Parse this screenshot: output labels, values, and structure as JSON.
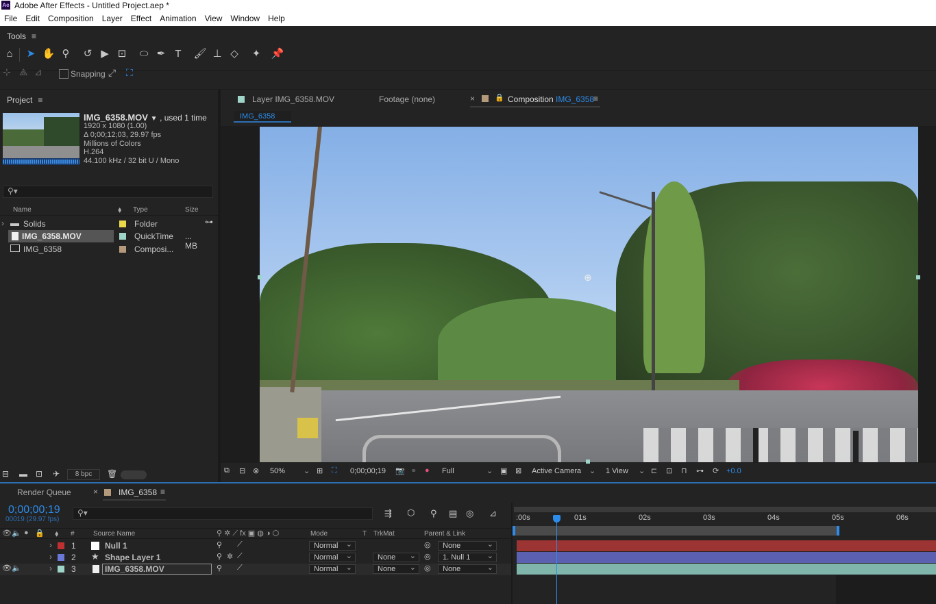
{
  "window": {
    "app_title": "Adobe After Effects - Untitled Project.aep *",
    "logo": "Ae"
  },
  "menu": [
    "File",
    "Edit",
    "Composition",
    "Layer",
    "Effect",
    "Animation",
    "View",
    "Window",
    "Help"
  ],
  "tools_panel": {
    "title": "Tools",
    "snapping_label": "Snapping"
  },
  "project": {
    "title": "Project",
    "selected_name": "IMG_6358.MOV",
    "used_text": ", used 1 time",
    "info": [
      "1920 x 1080 (1.00)",
      "Δ 0;00;12;03, 29.97 fps",
      "Millions of Colors",
      "H.264",
      "44.100 kHz / 32 bit U / Mono"
    ],
    "columns": {
      "name": "Name",
      "type": "Type",
      "size": "Size"
    },
    "items": [
      {
        "name": "Solids",
        "type": "Folder",
        "size": "",
        "color": "#e8d84a"
      },
      {
        "name": "IMG_6358.MOV",
        "type": "QuickTime",
        "size": "... MB",
        "color": "#9fd4c8"
      },
      {
        "name": "IMG_6358",
        "type": "Composi...",
        "size": "",
        "color": "#b49a7a"
      }
    ],
    "bpc": "8 bpc"
  },
  "viewer": {
    "tabs": {
      "layer": "Layer IMG_6358.MOV",
      "footage": "Footage (none)",
      "comp_prefix": "Composition",
      "comp_name": "IMG_6358"
    },
    "breadcrumb": "IMG_6358",
    "zoom": "50%",
    "timecode": "0;00;00;19",
    "resolution": "Full",
    "camera": "Active Camera",
    "views": "1 View",
    "exposure": "+0.0"
  },
  "timeline": {
    "tabs": {
      "render_queue": "Render Queue",
      "comp": "IMG_6358"
    },
    "current_time": "0;00;00;19",
    "frame_info": "00019 (29.97 fps)",
    "col_headers": {
      "num": "#",
      "source": "Source Name",
      "mode": "Mode",
      "t": "T",
      "trkmat": "TrkMat",
      "parent": "Parent & Link"
    },
    "ruler": [
      ":00s",
      "01s",
      "02s",
      "03s",
      "04s",
      "05s",
      "06s"
    ],
    "layers": [
      {
        "num": "1",
        "name": "Null 1",
        "mode": "Normal",
        "trkmat": "",
        "parent": "None",
        "label_color": "#c03030",
        "bar_color": "#9c3434"
      },
      {
        "num": "2",
        "name": "Shape Layer 1",
        "mode": "Normal",
        "trkmat": "None",
        "parent": "1. Null 1",
        "label_color": "#6a78d8",
        "bar_color": "#5c60b0"
      },
      {
        "num": "3",
        "name": "IMG_6358.MOV",
        "mode": "Normal",
        "trkmat": "None",
        "parent": "None",
        "label_color": "#9fd4c8",
        "bar_color": "#7fb5ab"
      }
    ]
  }
}
